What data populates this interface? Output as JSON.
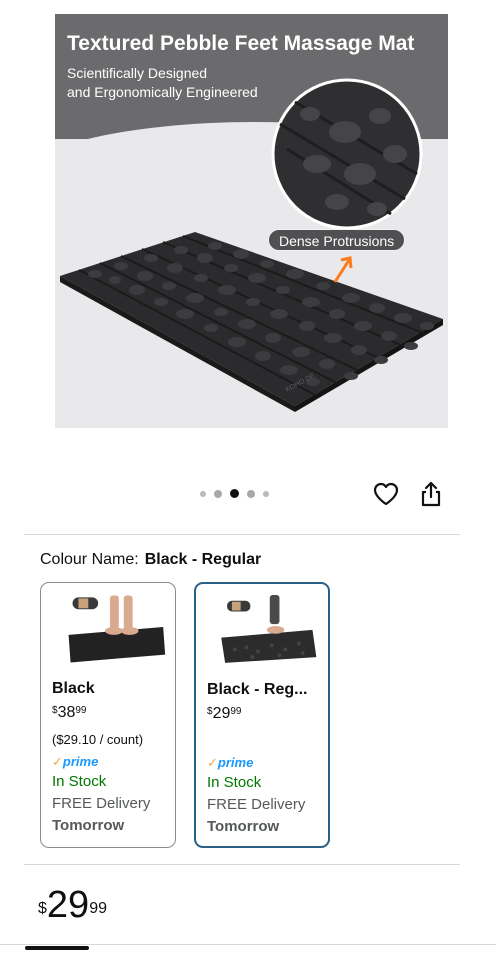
{
  "hero": {
    "title": "Textured Pebble Feet Massage Mat",
    "subtitle_lines": [
      "Scientifically Designed",
      "and Ergonomically Engineered"
    ],
    "callout": "Dense Protrusions",
    "mat_brand": "KOHO DE",
    "colors": {
      "banner": "#6b6b6d",
      "mat": "#2b2b2d",
      "arrow": "#ff7a1a"
    }
  },
  "carousel": {
    "total_images": 5,
    "active_index": 2
  },
  "actions": {
    "wishlist_icon": "heart-outline-icon",
    "share_icon": "share-icon"
  },
  "colour": {
    "label": "Colour Name:",
    "value": "Black - Regular"
  },
  "variants": [
    {
      "name": "Black",
      "price_symbol": "$",
      "price_whole": "38",
      "price_fraction": "99",
      "unit_price": "($29.10 / count)",
      "prime": "prime",
      "stock": "In Stock",
      "delivery": "FREE Delivery",
      "delivery_day": "Tomorrow",
      "selected": false
    },
    {
      "name": "Black - Reg...",
      "price_symbol": "$",
      "price_whole": "29",
      "price_fraction": "99",
      "unit_price": "",
      "prime": "prime",
      "stock": "In Stock",
      "delivery": "FREE Delivery",
      "delivery_day": "Tomorrow",
      "selected": true
    }
  ],
  "price": {
    "symbol": "$",
    "whole": "29",
    "fraction": "99"
  },
  "theme": {
    "selected_border": "#2a5f86",
    "stock_green": "#007600",
    "prime_blue": "#1a98ff"
  }
}
